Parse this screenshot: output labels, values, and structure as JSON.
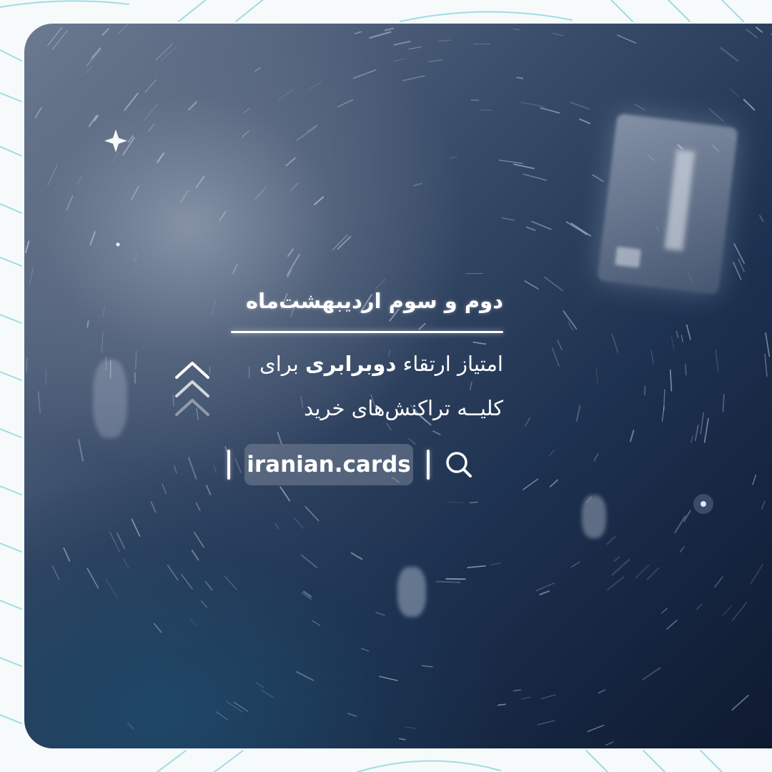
{
  "theme": {
    "frame_background": "#f6fafb",
    "pattern_color": "#9fdde3",
    "card_dark": "#0e1a30",
    "card_light": "#6d7b91",
    "text_color": "#ffffff"
  },
  "headline": {
    "date": "دوم و سوم اردیبهشت‌ماه"
  },
  "offer": {
    "line1_prefix": "امتیاز ارتقاء",
    "line1_bold": "دوبرابری",
    "line1_suffix": "برای",
    "line2": "کلیــه تراکنش‌های خرید"
  },
  "website": {
    "label": "iranian.cards"
  },
  "icons": {
    "chevrons": "triple-chevron-up-icon",
    "search": "search-icon",
    "sparkle": "sparkle-star-icon"
  }
}
